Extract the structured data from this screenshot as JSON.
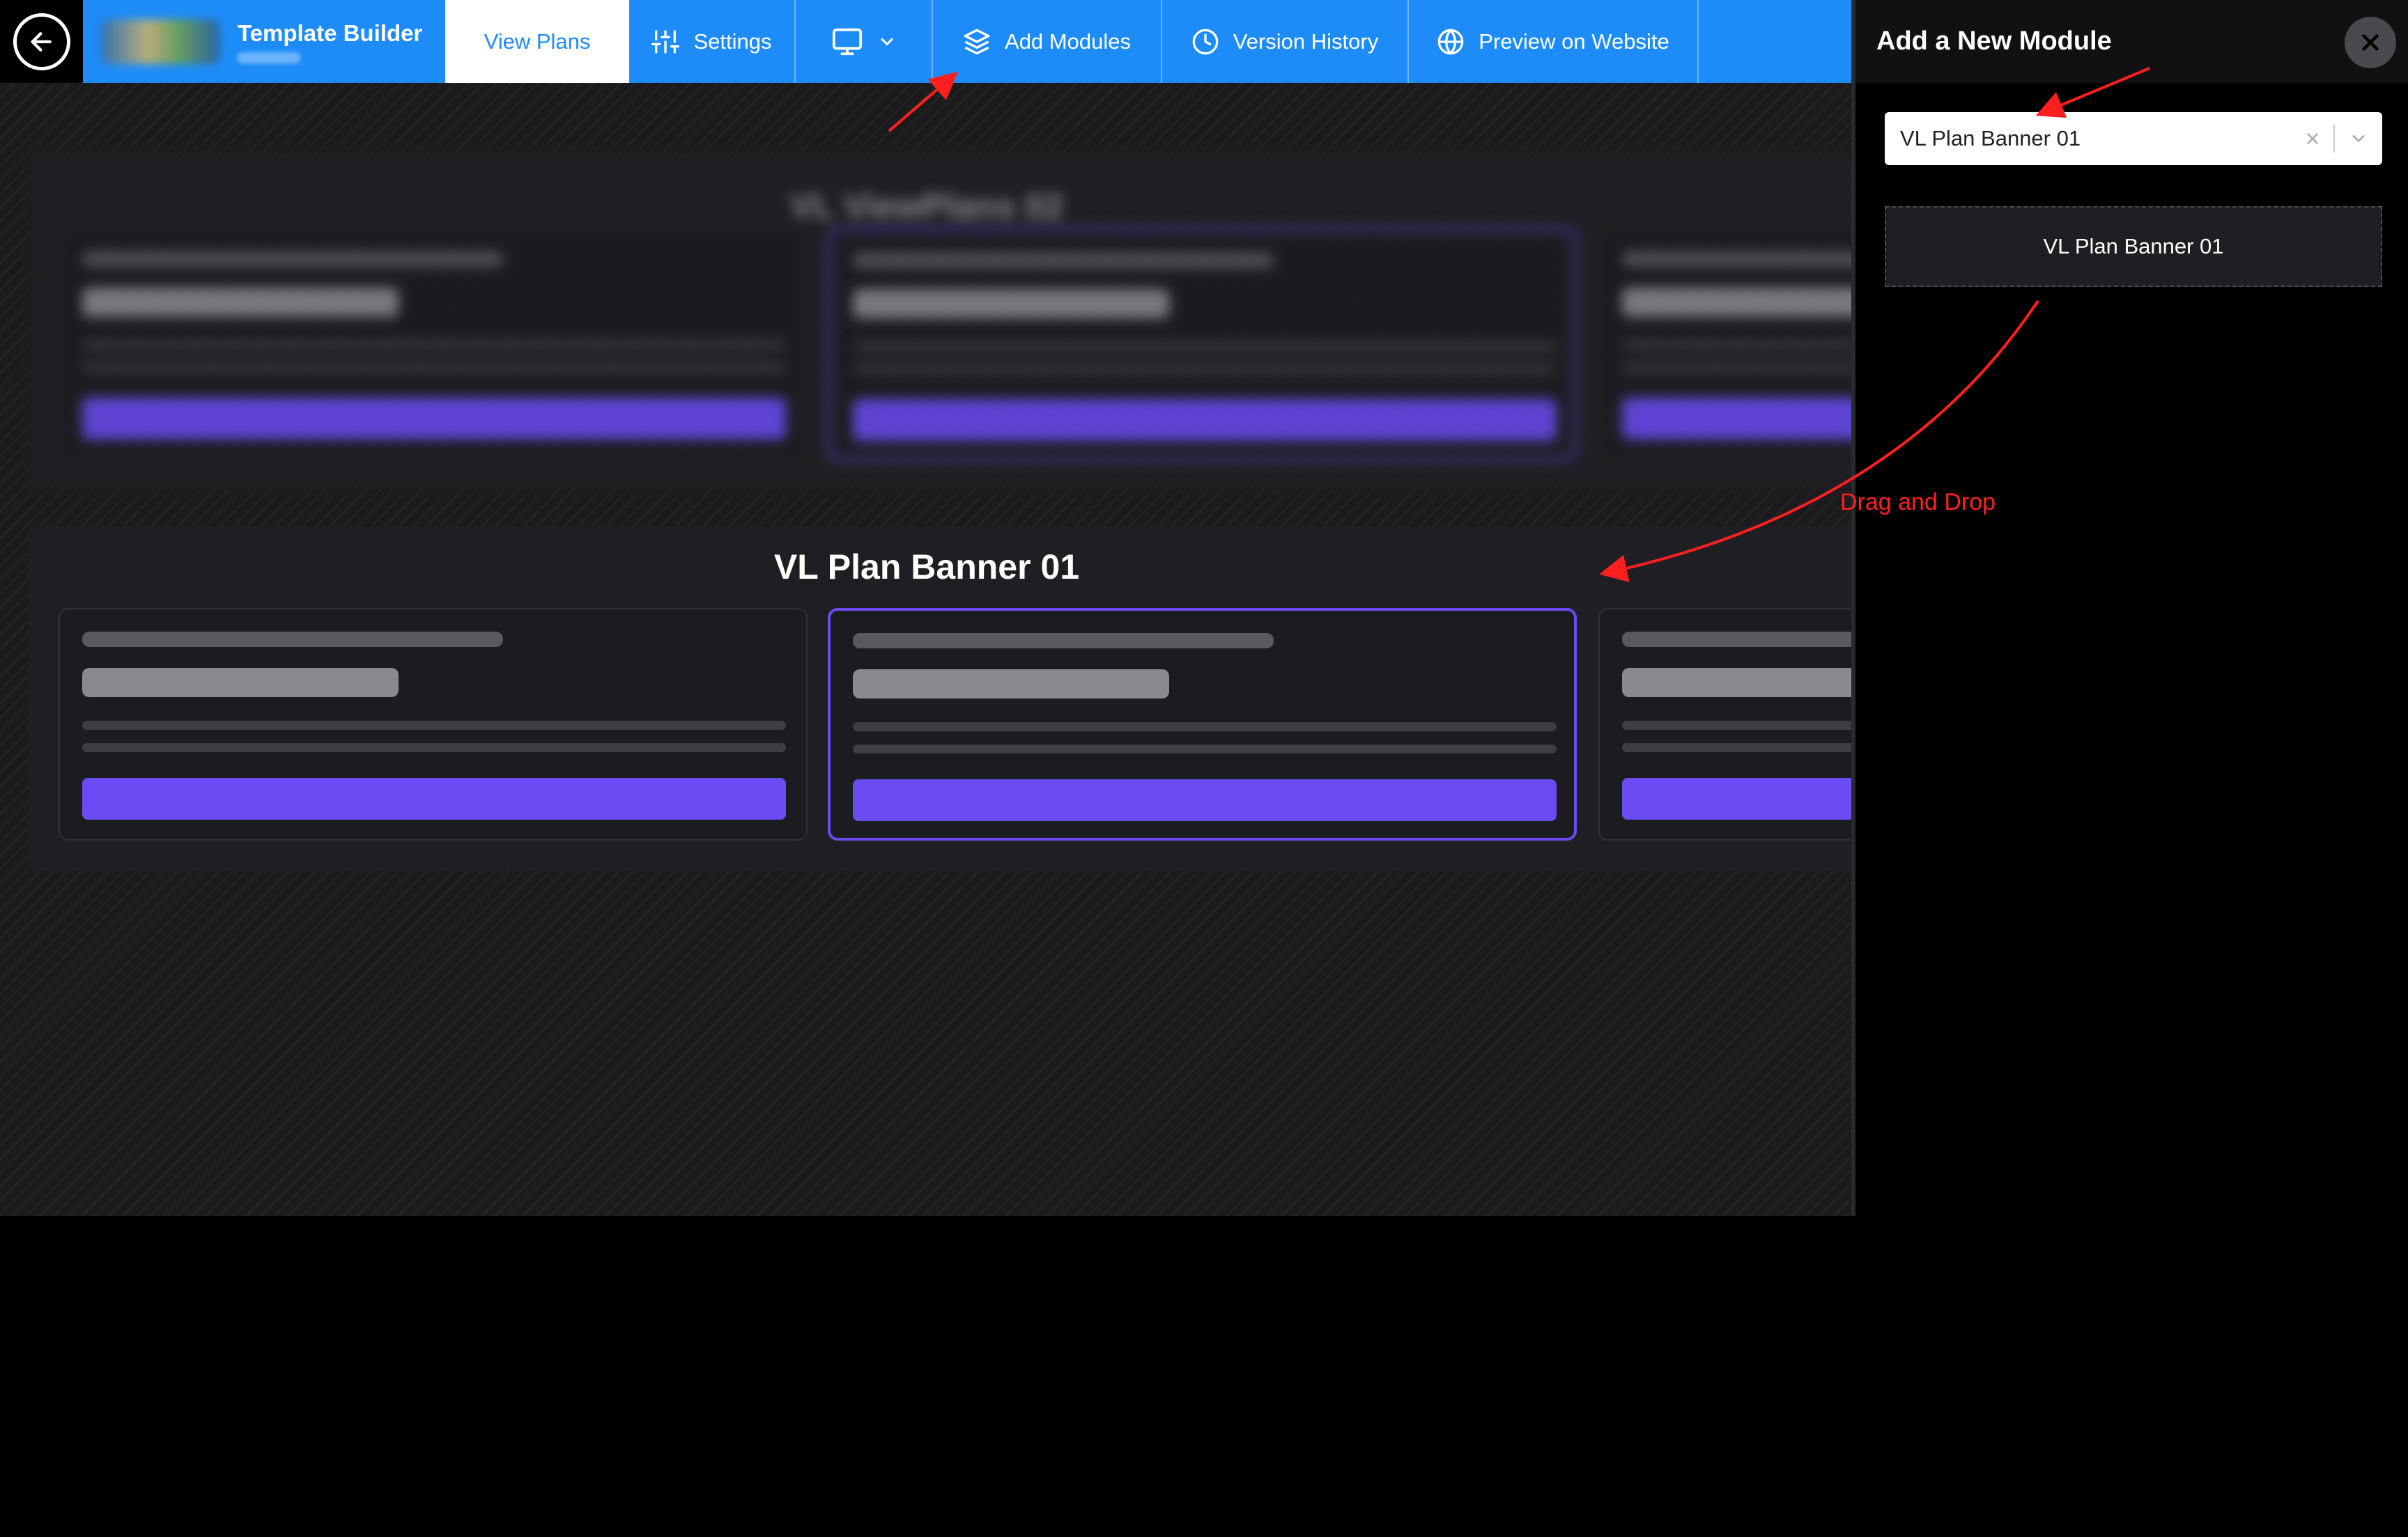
{
  "toolbar": {
    "title": "Template Builder",
    "tabs": [
      {
        "label": "View Plans",
        "icon": "none",
        "active": true
      },
      {
        "label": "Settings",
        "icon": "sliders-icon"
      },
      {
        "label": "",
        "icon": "monitor-icon"
      },
      {
        "label": "Add Modules",
        "icon": "layers-icon"
      },
      {
        "label": "Version History",
        "icon": "clock-icon"
      },
      {
        "label": "Preview on Website",
        "icon": "globe-icon"
      }
    ],
    "accent_color": "#1d8cf8"
  },
  "canvas": {
    "modules": [
      {
        "title": "VL ViewPlans 02",
        "blurred": true
      },
      {
        "title": "VL Plan Banner 01",
        "blurred": false
      }
    ],
    "button_color": "#6b4cf3"
  },
  "panel": {
    "title": "Add a New Module",
    "select_value": "VL Plan Banner 01",
    "module_item": "VL Plan Banner 01"
  },
  "annotations": {
    "drag_label": "Drag and Drop",
    "color": "#ff1f1f"
  }
}
